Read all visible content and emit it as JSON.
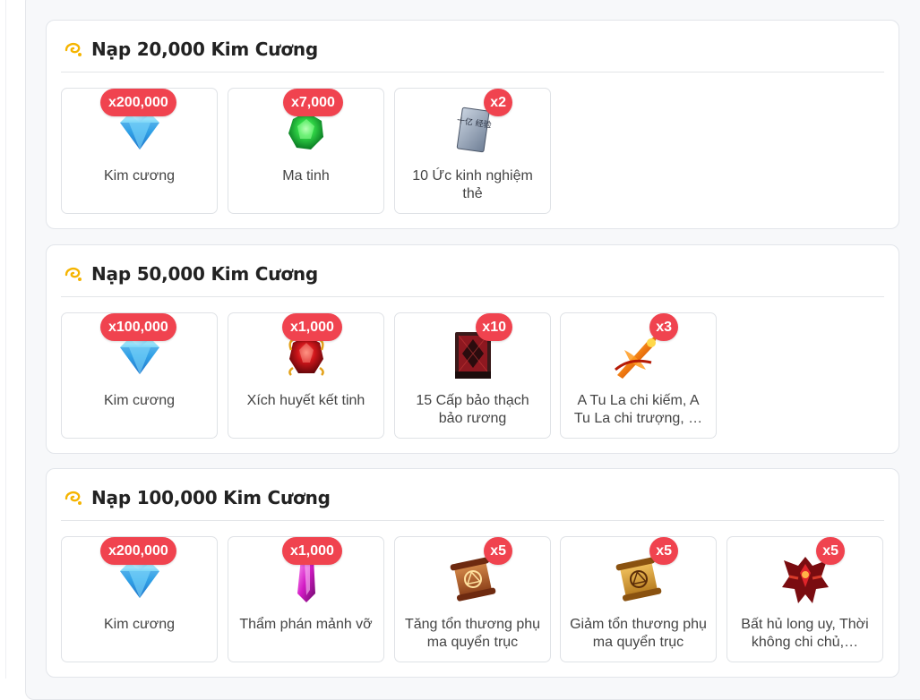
{
  "sections": [
    {
      "title": "Nạp 20,000 Kim Cương",
      "items": [
        {
          "name": "Kim cương",
          "qty": "x200,000",
          "icon": "diamond-icon"
        },
        {
          "name": "Ma tinh",
          "qty": "x7,000",
          "icon": "green-gem-icon"
        },
        {
          "name": "10 Ức kinh nghiệm thẻ",
          "qty": "x2",
          "icon": "exp-card-icon",
          "card_text": "十亿 经验"
        }
      ]
    },
    {
      "title": "Nạp 50,000 Kim Cương",
      "items": [
        {
          "name": "Kim cương",
          "qty": "x100,000",
          "icon": "diamond-icon"
        },
        {
          "name": "Xích huyết kết tinh",
          "qty": "x1,000",
          "icon": "red-crystal-icon"
        },
        {
          "name": "15 Cấp bảo thạch bảo rương",
          "qty": "x10",
          "icon": "treasure-chest-icon"
        },
        {
          "name": "A Tu La chi kiếm, A Tu La chi trượng, …",
          "qty": "x3",
          "icon": "flaming-sword-icon"
        }
      ]
    },
    {
      "title": "Nạp 100,000 Kim Cương",
      "items": [
        {
          "name": "Kim cương",
          "qty": "x200,000",
          "icon": "diamond-icon"
        },
        {
          "name": "Thẩm phán mảnh vỡ",
          "qty": "x1,000",
          "icon": "purple-shard-icon"
        },
        {
          "name": "Tăng tổn thương phụ ma quyển trục",
          "qty": "x5",
          "icon": "scroll-icon"
        },
        {
          "name": "Giảm tổn thương phụ ma quyển trục",
          "qty": "x5",
          "icon": "golden-scroll-icon"
        },
        {
          "name": "Bất hủ long uy, Thời không chi chủ,…",
          "qty": "x5",
          "icon": "demon-armor-icon"
        }
      ]
    }
  ],
  "colors": {
    "badge": "#f0434f",
    "title": "#222222",
    "text": "#444444"
  }
}
